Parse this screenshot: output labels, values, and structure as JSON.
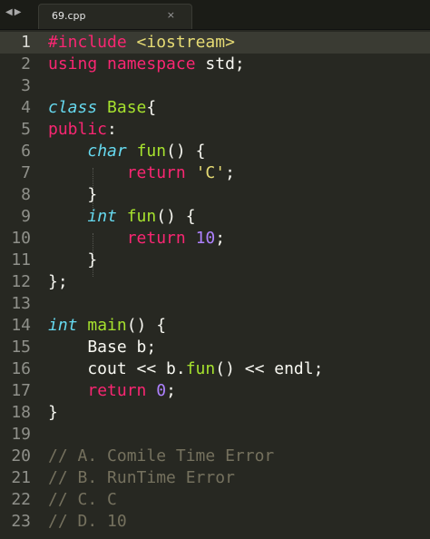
{
  "tab": {
    "title": "69.cpp",
    "close_glyph": "×",
    "back_glyph": "◀",
    "forward_glyph": "▶"
  },
  "active_line": 1,
  "lines": [
    {
      "number": "1",
      "code": "#include <iostream>"
    },
    {
      "number": "2",
      "code": "using namespace std;"
    },
    {
      "number": "3",
      "code": ""
    },
    {
      "number": "4",
      "code": "class Base{"
    },
    {
      "number": "5",
      "code": "public:"
    },
    {
      "number": "6",
      "code": "    char fun() {"
    },
    {
      "number": "7",
      "code": "        return 'C';"
    },
    {
      "number": "8",
      "code": "    }"
    },
    {
      "number": "9",
      "code": "    int fun() {"
    },
    {
      "number": "10",
      "code": "        return 10;"
    },
    {
      "number": "11",
      "code": "    }"
    },
    {
      "number": "12",
      "code": "};"
    },
    {
      "number": "13",
      "code": ""
    },
    {
      "number": "14",
      "code": "int main() {"
    },
    {
      "number": "15",
      "code": "    Base b;"
    },
    {
      "number": "16",
      "code": "    cout << b.fun() << endl;"
    },
    {
      "number": "17",
      "code": "    return 0;"
    },
    {
      "number": "18",
      "code": "}"
    },
    {
      "number": "19",
      "code": ""
    },
    {
      "number": "20",
      "code": "// A. Comile Time Error"
    },
    {
      "number": "21",
      "code": "// B. RunTime Error"
    },
    {
      "number": "22",
      "code": "// C. C"
    },
    {
      "number": "23",
      "code": "// D. 10"
    }
  ],
  "theme": {
    "background": "#272822",
    "keyword": "#f92672",
    "type": "#66d9ef",
    "function": "#a6e22e",
    "string": "#e6db74",
    "number": "#ae81ff",
    "comment": "#75715e",
    "foreground": "#f8f8f2"
  }
}
